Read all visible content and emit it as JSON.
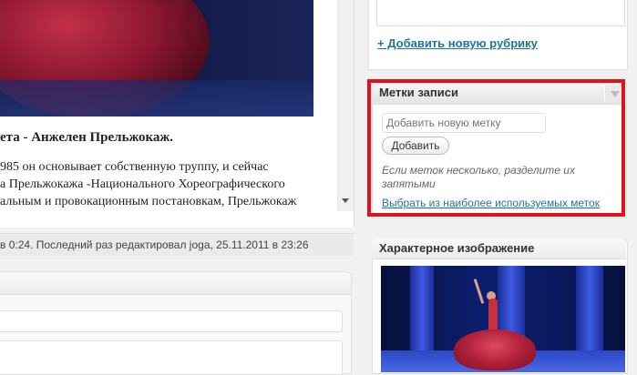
{
  "editor": {
    "heading": "ета - Анжелен Прельжокаж.",
    "lines": [
      "985 он основывает собственную труппу, и сейчас",
      "а Прельжокажа -Национального Хореографического",
      "альным и провокационным постановкам, Прельжокаж"
    ]
  },
  "status_bar": "в 0:24. Последний раз редактировал joga, 25.11.2011 в 23:26",
  "categories": {
    "add_link": "+ Добавить новую рубрику"
  },
  "tags_box": {
    "title": "Метки записи",
    "input_placeholder": "Добавить новую метку",
    "add_button": "Добавить",
    "hint": "Если меток несколько, разделите их запятыми",
    "popular_link": "Выбрать из наиболее используемых меток",
    "highlight_color": "#e0131b"
  },
  "featured_image": {
    "title": "Характерное изображение"
  },
  "colors": {
    "link": "#21759b",
    "background": "#f1f1f1"
  }
}
